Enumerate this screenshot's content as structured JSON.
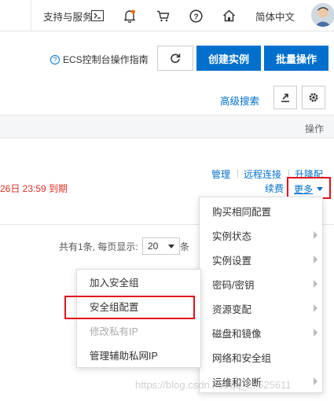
{
  "topbar": {
    "support": "支持与服务",
    "language": "简体中文",
    "icons": [
      "terminal-icon",
      "bell-icon",
      "cart-icon",
      "help-icon",
      "home-icon"
    ]
  },
  "toolbar": {
    "guide_link": "ECS控制台操作指南",
    "create_instance": "创建实例",
    "batch_ops": "批量操作",
    "advanced_search": "高级搜索"
  },
  "table": {
    "op_header": "操作",
    "expire_text": "26日 23:59 到期",
    "actions": {
      "manage": "管理",
      "remote": "远程连接",
      "upgrade": "升降配",
      "renew": "续费",
      "more": "更多"
    }
  },
  "pagination": {
    "summary": "共有1条, 每页显示:",
    "page_size": "20",
    "suffix": "条"
  },
  "more_menu": [
    {
      "label": "购买相同配置",
      "submenu": false
    },
    {
      "label": "实例状态",
      "submenu": true
    },
    {
      "label": "实例设置",
      "submenu": true
    },
    {
      "label": "密码/密钥",
      "submenu": true
    },
    {
      "label": "资源变配",
      "submenu": true
    },
    {
      "label": "磁盘和镜像",
      "submenu": true
    },
    {
      "label": "网络和安全组",
      "submenu": false
    },
    {
      "label": "运维和诊断",
      "submenu": true
    }
  ],
  "security_submenu": [
    {
      "label": "加入安全组",
      "disabled": false
    },
    {
      "label": "安全组配置",
      "disabled": false
    },
    {
      "label": "修改私有IP",
      "disabled": true
    },
    {
      "label": "管理辅助私网IP",
      "disabled": false
    }
  ],
  "watermark": "https://blog.csdn.net/qq_27525611",
  "colors": {
    "primary": "#0070cc",
    "danger": "#d93026",
    "highlight": "#e3101a"
  }
}
